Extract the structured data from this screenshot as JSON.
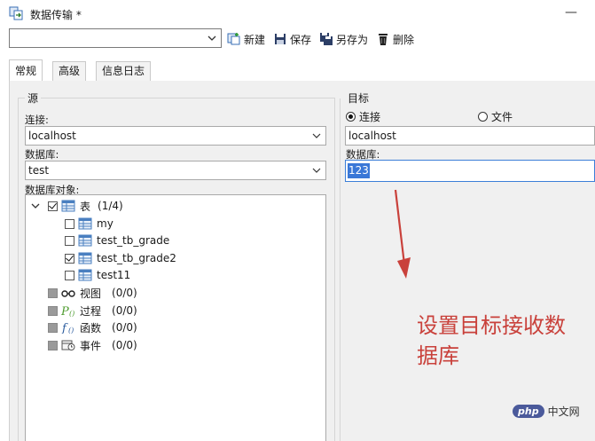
{
  "window": {
    "title": "数据传输 *"
  },
  "toolbar": {
    "profile_value": "",
    "new_label": "新建",
    "save_label": "保存",
    "save_as_label": "另存为",
    "delete_label": "删除"
  },
  "tabs": [
    {
      "label": "常规",
      "active": true
    },
    {
      "label": "高级",
      "active": false
    },
    {
      "label": "信息日志",
      "active": false
    }
  ],
  "source": {
    "title": "源",
    "connection_label": "连接:",
    "connection_value": "localhost",
    "database_label": "数据库:",
    "database_value": "test",
    "objects_label": "数据库对象:",
    "tree": {
      "tables": {
        "label": "表",
        "count": "(1/4)"
      },
      "table_items": [
        {
          "name": "my",
          "checked": false
        },
        {
          "name": "test_tb_grade",
          "checked": false
        },
        {
          "name": "test_tb_grade2",
          "checked": true
        },
        {
          "name": "test11",
          "checked": false
        }
      ],
      "views": {
        "label": "视图",
        "count": "(0/0)"
      },
      "procedures": {
        "label": "过程",
        "count": "(0/0)"
      },
      "functions": {
        "label": "函数",
        "count": "(0/0)"
      },
      "events": {
        "label": "事件",
        "count": "(0/0)"
      }
    }
  },
  "target": {
    "title": "目标",
    "radio_connection_label": "连接",
    "radio_file_label": "文件",
    "selected": "connection",
    "connection_value": "localhost",
    "database_label": "数据库:",
    "database_value": "123"
  },
  "annotation": {
    "line1": "设置目标接收数",
    "line2": "据库"
  },
  "watermark": {
    "badge": "php",
    "text": "中文网"
  },
  "colors": {
    "annotation": "#c9413b",
    "selection": "#3a78d7",
    "panel": "#f0f0f0"
  }
}
